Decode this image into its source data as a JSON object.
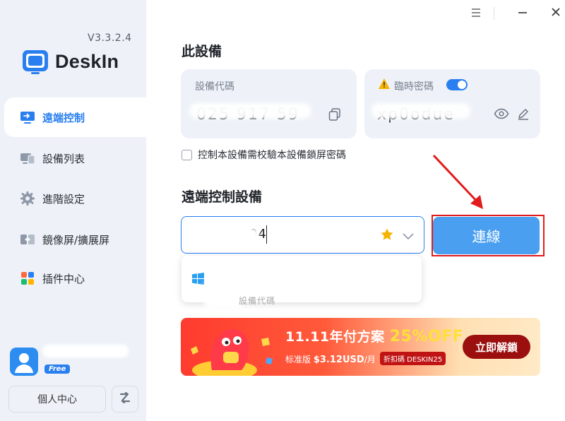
{
  "app": {
    "version": "V3.3.2.4",
    "logo_text": "DeskIn"
  },
  "sidebar": {
    "items": [
      {
        "label": "遠端控制",
        "icon": "remote-screen-icon",
        "active": true
      },
      {
        "label": "設備列表",
        "icon": "devices-icon"
      },
      {
        "label": "進階設定",
        "icon": "gear-icon"
      },
      {
        "label": "鏡像屏/擴展屏",
        "icon": "mirror-screen-icon"
      },
      {
        "label": "插件中心",
        "icon": "plugins-icon"
      }
    ],
    "user_badge": "Free",
    "profile_button": "個人中心",
    "switch_icon": "switch-account-icon"
  },
  "this_device": {
    "title": "此設備",
    "device_code_label": "設備代碼",
    "device_code_value": "025 917 59",
    "temp_password_label": "臨時密碼",
    "temp_password_value": "xp0odue",
    "temp_password_enabled": true,
    "lock_checkbox_label": "控制本設備需校驗本設備鎖屏密碼",
    "lock_checkbox_checked": false
  },
  "remote": {
    "title": "遠端控制設備",
    "input_value": "04",
    "connect_button": "連線"
  },
  "dropdown": {
    "item_icon": "windows-icon",
    "hint": "設備代碼"
  },
  "banner": {
    "title": "11.11年付方案",
    "discount": "25%OFF",
    "edition": "标准版",
    "price": "$3.12USD",
    "per": "/月",
    "code": "折扣碼 DESKIN25",
    "cta": "立即解鎖"
  },
  "colors": {
    "accent": "#2a7ff0",
    "sidebar_bg": "#eef2f8",
    "connect_button": "#4a9ff0",
    "highlight_box": "#e21c1c"
  }
}
